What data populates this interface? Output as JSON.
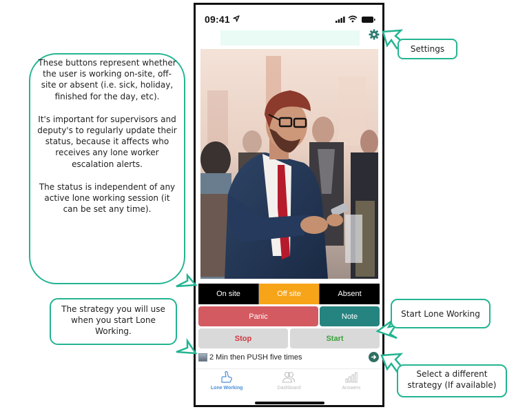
{
  "statusbar": {
    "time": "09:41",
    "icons": [
      "location-arrow-icon",
      "signal-icon",
      "wifi-icon",
      "battery-icon"
    ]
  },
  "header": {
    "settings_icon": "gear-icon"
  },
  "photo": {
    "description": "Man in suit with red tie looking at smartphone on a busy street"
  },
  "status_segment": {
    "options": [
      {
        "label": "On site",
        "active": false
      },
      {
        "label": "Off site",
        "active": true
      },
      {
        "label": "Absent",
        "active": false
      }
    ]
  },
  "actions": {
    "panic": "Panic",
    "note": "Note",
    "stop": "Stop",
    "start": "Start"
  },
  "strategy": {
    "label": "2 Min then PUSH five times",
    "next_icon": "arrow-right-circle-icon"
  },
  "tabbar": {
    "tabs": [
      {
        "label": "Lone Working",
        "icon": "hand-tap-icon",
        "active": true
      },
      {
        "label": "Dashboard",
        "icon": "users-icon",
        "active": false
      },
      {
        "label": "Answers",
        "icon": "bar-chart-icon",
        "active": false
      }
    ]
  },
  "colors": {
    "accent_callout": "#23b491",
    "active_status": "#f7a418",
    "panic": "#d45a61",
    "note": "#268480",
    "stop_text": "#d2353e",
    "start_text": "#38a13a",
    "tab_active": "#4a8fd8"
  },
  "callouts": {
    "status": {
      "paragraphs": [
        "These buttons represent whether the user is working on-site, off-site or absent (i.e. sick, holiday, finished for the day, etc).",
        "It's important for supervisors and deputy's to regularly update their status, because it affects who receives any lone worker escalation alerts.",
        "The status is independent of any active lone working session (it can be set any time)."
      ]
    },
    "strategy": "The strategy you will use when you start Lone Working.",
    "settings": "Settings",
    "start": "Start Lone Working",
    "select": "Select a different strategy (If available)"
  }
}
